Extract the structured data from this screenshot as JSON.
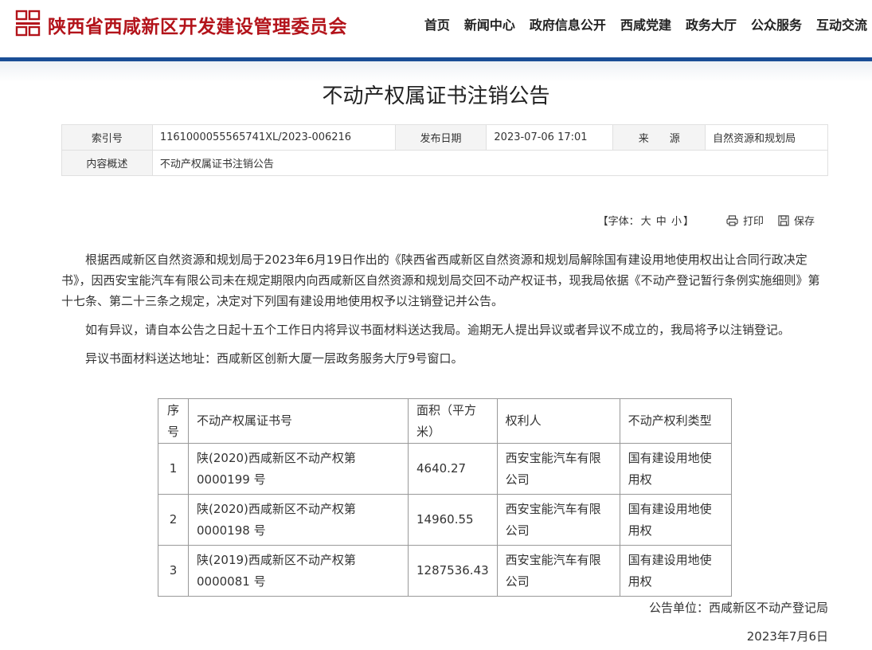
{
  "header": {
    "site_title": "陕西省西咸新区开发建设管理委员会",
    "nav": [
      "首页",
      "新闻中心",
      "政府信息公开",
      "西咸党建",
      "政务大厅",
      "公众服务",
      "互动交流"
    ],
    "colors": {
      "brand_red": "#b3141b",
      "bar_blue": "#1a4e96"
    }
  },
  "article": {
    "title": "不动产权属证书注销公告",
    "meta": {
      "index_label": "索引号",
      "index_value": "1161000055565741XL/2023-006216",
      "date_label": "发布日期",
      "date_value": "2023-07-06 17:01",
      "source_label": "来　　源",
      "source_value": "自然资源和规划局",
      "summary_label": "内容概述",
      "summary_value": "不动产权属证书注销公告"
    },
    "tools": {
      "font_label": "【字体：",
      "font_large": "大",
      "font_medium": "中",
      "font_small": "小",
      "font_end": "】",
      "print_label": "打印",
      "save_label": "保存"
    },
    "paragraphs": [
      "根据西咸新区自然资源和规划局于2023年6月19日作出的《陕西省西咸新区自然资源和规划局解除国有建设用地使用权出让合同行政决定书》，因西安宝能汽车有限公司未在规定期限内向西咸新区自然资源和规划局交回不动产权证书，现我局依据《不动产登记暂行条例实施细则》第十七条、第二十三条之规定，决定对下列国有建设用地使用权予以注销登记并公告。",
      "如有异议，请自本公告之日起十五个工作日内将异议书面材料送达我局。逾期无人提出异议或者异议不成立的，我局将予以注销登记。",
      "异议书面材料送达地址：西咸新区创新大厦一层政务服务大厅9号窗口。"
    ],
    "table": {
      "headers": [
        "序号",
        "不动产权属证书号",
        "面积（平方米）",
        "权利人",
        "不动产权利类型"
      ],
      "rows": [
        [
          "1",
          "陕(2020)西咸新区不动产权第0000199 号",
          "4640.27",
          "西安宝能汽车有限公司",
          "国有建设用地使用权"
        ],
        [
          "2",
          "陕(2020)西咸新区不动产权第0000198 号",
          "14960.55",
          "西安宝能汽车有限公司",
          "国有建设用地使用权"
        ],
        [
          "3",
          "陕(2019)西咸新区不动产权第0000081 号",
          "1287536.43",
          "西安宝能汽车有限公司",
          "国有建设用地使用权"
        ]
      ]
    },
    "signature": "公告单位：西咸新区不动产登记局",
    "sign_date": "2023年7月6日"
  }
}
